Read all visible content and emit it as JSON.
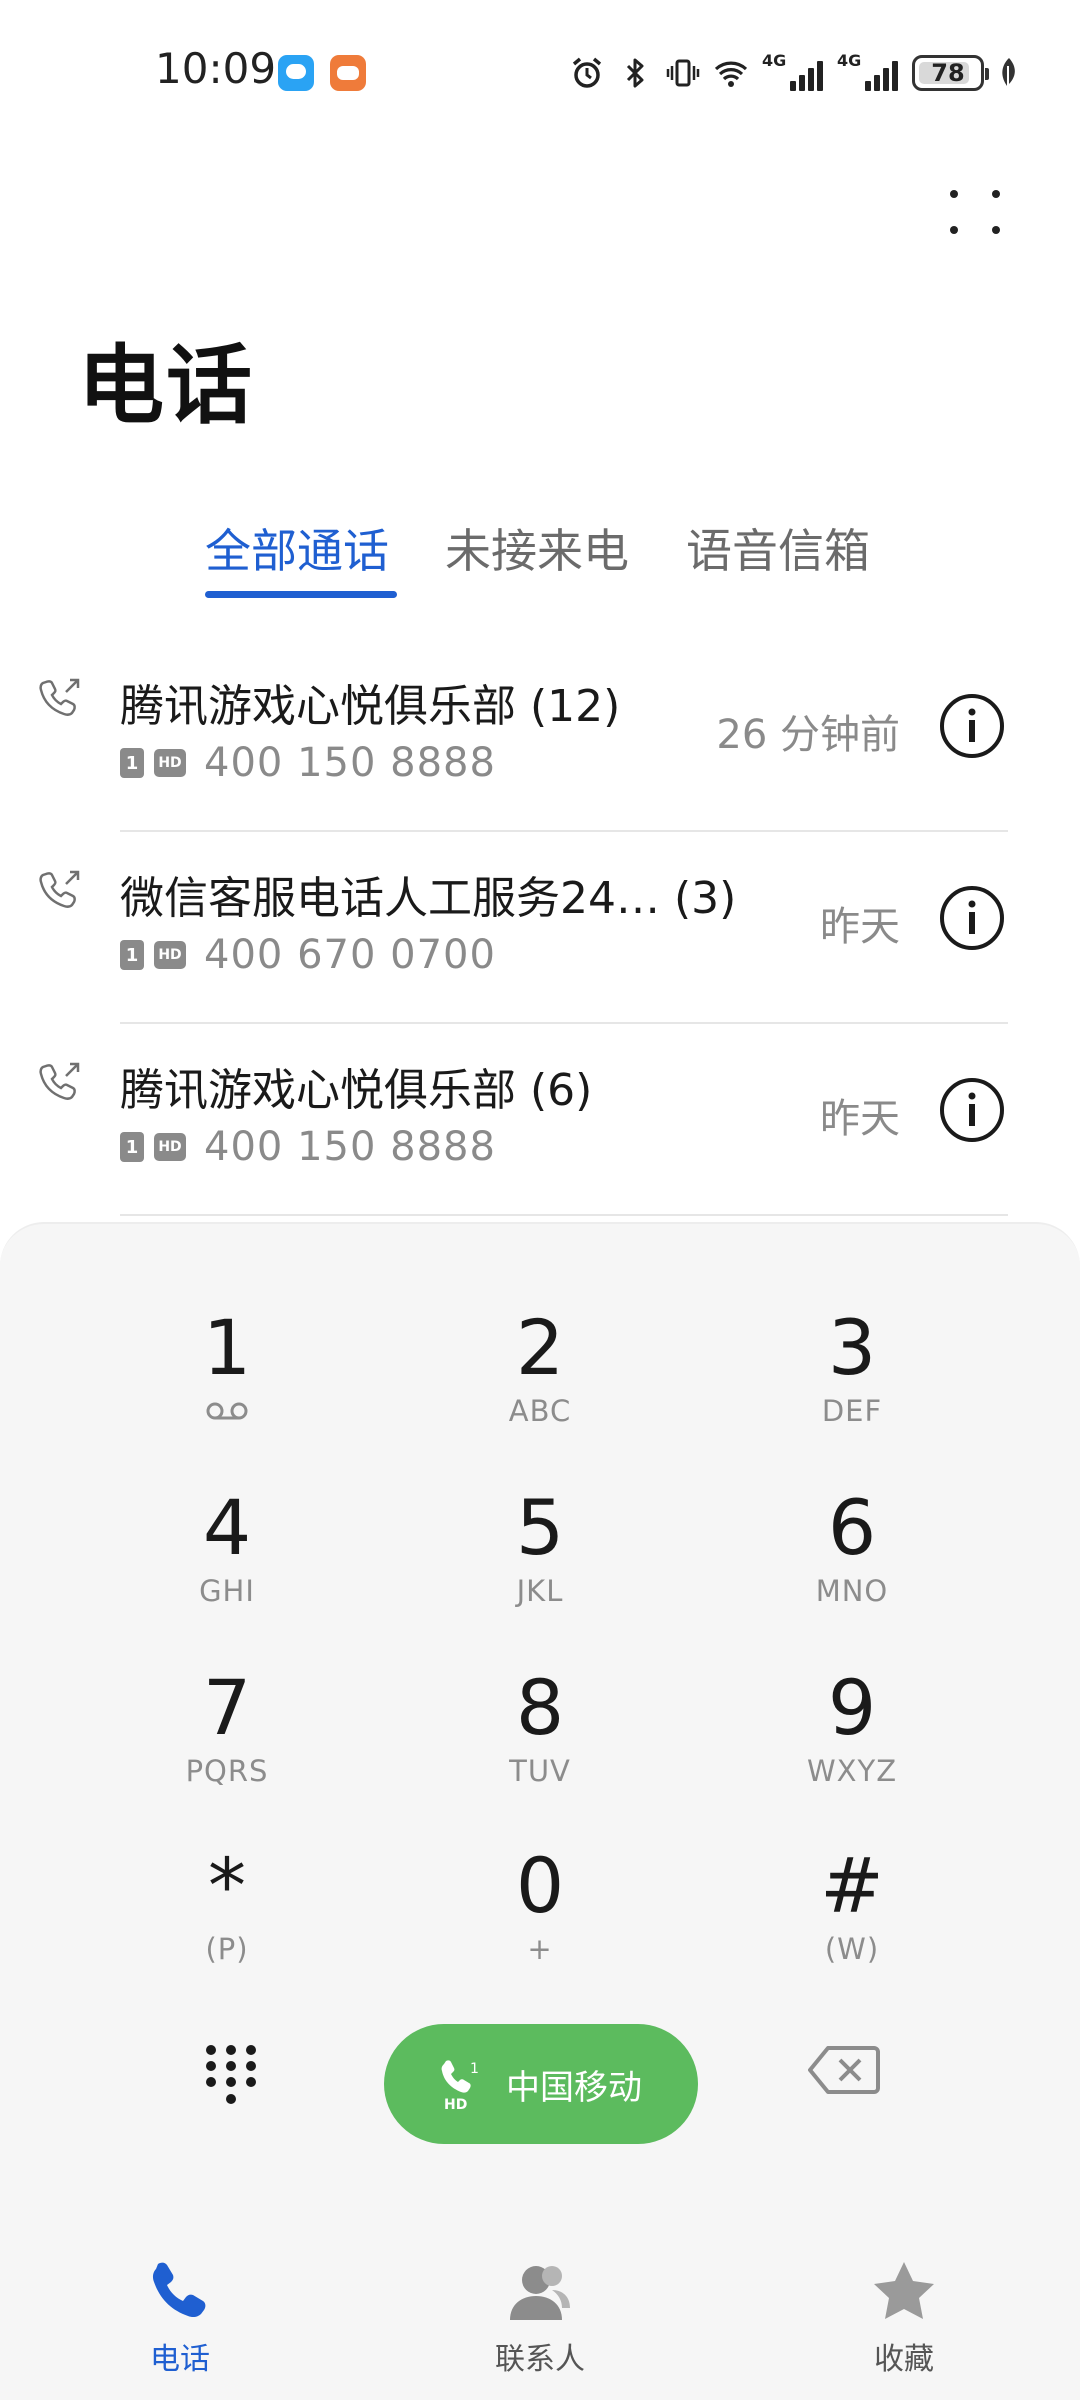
{
  "status_bar": {
    "time": "10:09",
    "battery": "78",
    "network_1": "4G",
    "network_2": "4G"
  },
  "header": {
    "title": "电话",
    "more_icon": "more-dots-icon"
  },
  "tabs": [
    {
      "label": "全部通话",
      "active": true
    },
    {
      "label": "未接来电",
      "active": false
    },
    {
      "label": "语音信箱",
      "active": false
    }
  ],
  "call_log": [
    {
      "name": "腾讯游戏心悦俱乐部 (12)",
      "sim": "1",
      "hd": "HD",
      "number": "400 150 8888",
      "time": "26 分钟前"
    },
    {
      "name": "微信客服电话人工服务24… (3)",
      "sim": "1",
      "hd": "HD",
      "number": "400 670 0700",
      "time": "昨天"
    },
    {
      "name": "腾讯游戏心悦俱乐部 (6)",
      "sim": "1",
      "hd": "HD",
      "number": "400 150 8888",
      "time": "昨天"
    }
  ],
  "dialpad": {
    "keys": [
      {
        "digit": "1",
        "letters": ""
      },
      {
        "digit": "2",
        "letters": "ABC"
      },
      {
        "digit": "3",
        "letters": "DEF"
      },
      {
        "digit": "4",
        "letters": "GHI"
      },
      {
        "digit": "5",
        "letters": "JKL"
      },
      {
        "digit": "6",
        "letters": "MNO"
      },
      {
        "digit": "7",
        "letters": "PQRS"
      },
      {
        "digit": "8",
        "letters": "TUV"
      },
      {
        "digit": "9",
        "letters": "WXYZ"
      },
      {
        "digit": "*",
        "letters": "(P)"
      },
      {
        "digit": "0",
        "letters": "+"
      },
      {
        "digit": "#",
        "letters": "(W)"
      }
    ],
    "call_button_label": "中国移动",
    "call_button_color": "#5cbb5e"
  },
  "bottom_nav": [
    {
      "label": "电话",
      "icon": "phone-icon",
      "active": true
    },
    {
      "label": "联系人",
      "icon": "contacts-icon",
      "active": false
    },
    {
      "label": "收藏",
      "icon": "star-icon",
      "active": false
    }
  ],
  "colors": {
    "accent": "#1f5fd1",
    "secondary_text": "#8a8a8a"
  }
}
